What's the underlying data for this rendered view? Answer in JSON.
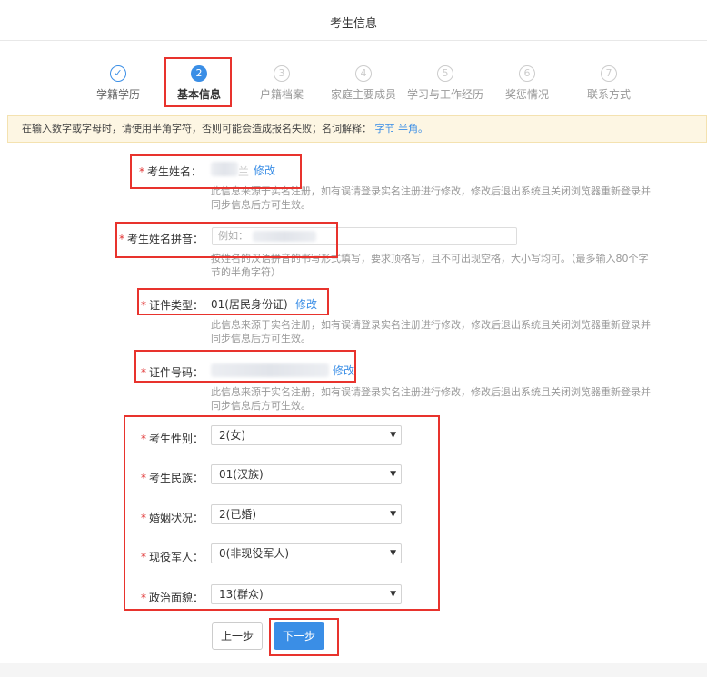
{
  "header": {
    "title": "考生信息"
  },
  "steps": [
    {
      "marker": "✓",
      "label": "学籍学历",
      "state": "done"
    },
    {
      "marker": "2",
      "label": "基本信息",
      "state": "active"
    },
    {
      "marker": "3",
      "label": "户籍档案",
      "state": "pending"
    },
    {
      "marker": "4",
      "label": "家庭主要成员",
      "state": "pending"
    },
    {
      "marker": "5",
      "label": "学习与工作经历",
      "state": "pending"
    },
    {
      "marker": "6",
      "label": "奖惩情况",
      "state": "pending"
    },
    {
      "marker": "7",
      "label": "联系方式",
      "state": "pending"
    }
  ],
  "notice": {
    "text": "在输入数字或字母时，请使用半角字符，否则可能会造成报名失败；名词解释：",
    "link1": "字节",
    "link2": "半角。"
  },
  "form": {
    "required_mark": "*",
    "name": {
      "label": "考生姓名：",
      "visible_char": "兰",
      "edit": "修改",
      "hint": "此信息来源于实名注册，如有误请登录实名注册进行修改，修改后退出系统且关闭浏览器重新登录并同步信息后方可生效。"
    },
    "pinyin": {
      "label": "考生姓名拼音：",
      "placeholder": "例如：",
      "hint": "按姓名的汉语拼音的书写形式填写，要求顶格写，且不可出现空格，大小写均可。（最多输入80个字节的半角字符）"
    },
    "id_type": {
      "label": "证件类型：",
      "value": "01(居民身份证)",
      "edit": "修改",
      "hint": "此信息来源于实名注册，如有误请登录实名注册进行修改，修改后退出系统且关闭浏览器重新登录并同步信息后方可生效。"
    },
    "id_number": {
      "label": "证件号码：",
      "edit": "修改",
      "hint": "此信息来源于实名注册，如有误请登录实名注册进行修改，修改后退出系统且关闭浏览器重新登录并同步信息后方可生效。"
    },
    "gender": {
      "label": "考生性别：",
      "value": "2(女)"
    },
    "ethnicity": {
      "label": "考生民族：",
      "value": "01(汉族)"
    },
    "marital": {
      "label": "婚姻状况：",
      "value": "2(已婚)"
    },
    "military": {
      "label": "现役军人：",
      "value": "0(非现役军人)"
    },
    "political": {
      "label": "政治面貌：",
      "value": "13(群众)"
    }
  },
  "buttons": {
    "prev": "上一步",
    "next": "下一步"
  },
  "colors": {
    "accent": "#3a8ee6",
    "required": "#e03030",
    "highlight": "#e8332d",
    "notice_bg": "#fdf6e3"
  }
}
